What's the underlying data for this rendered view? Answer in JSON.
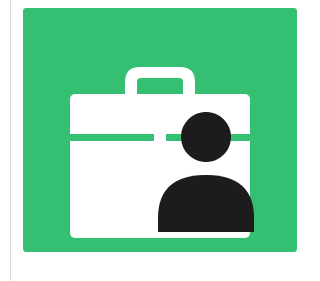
{
  "app_icon": {
    "name": "work-profile-app-icon",
    "icon_names": [
      "briefcase-icon",
      "person-icon"
    ],
    "colors": {
      "background": "#34bf73",
      "briefcase": "#ffffff",
      "person": "#1c1c1c",
      "page": "#ffffff",
      "divider": "#d8d8d8"
    }
  }
}
